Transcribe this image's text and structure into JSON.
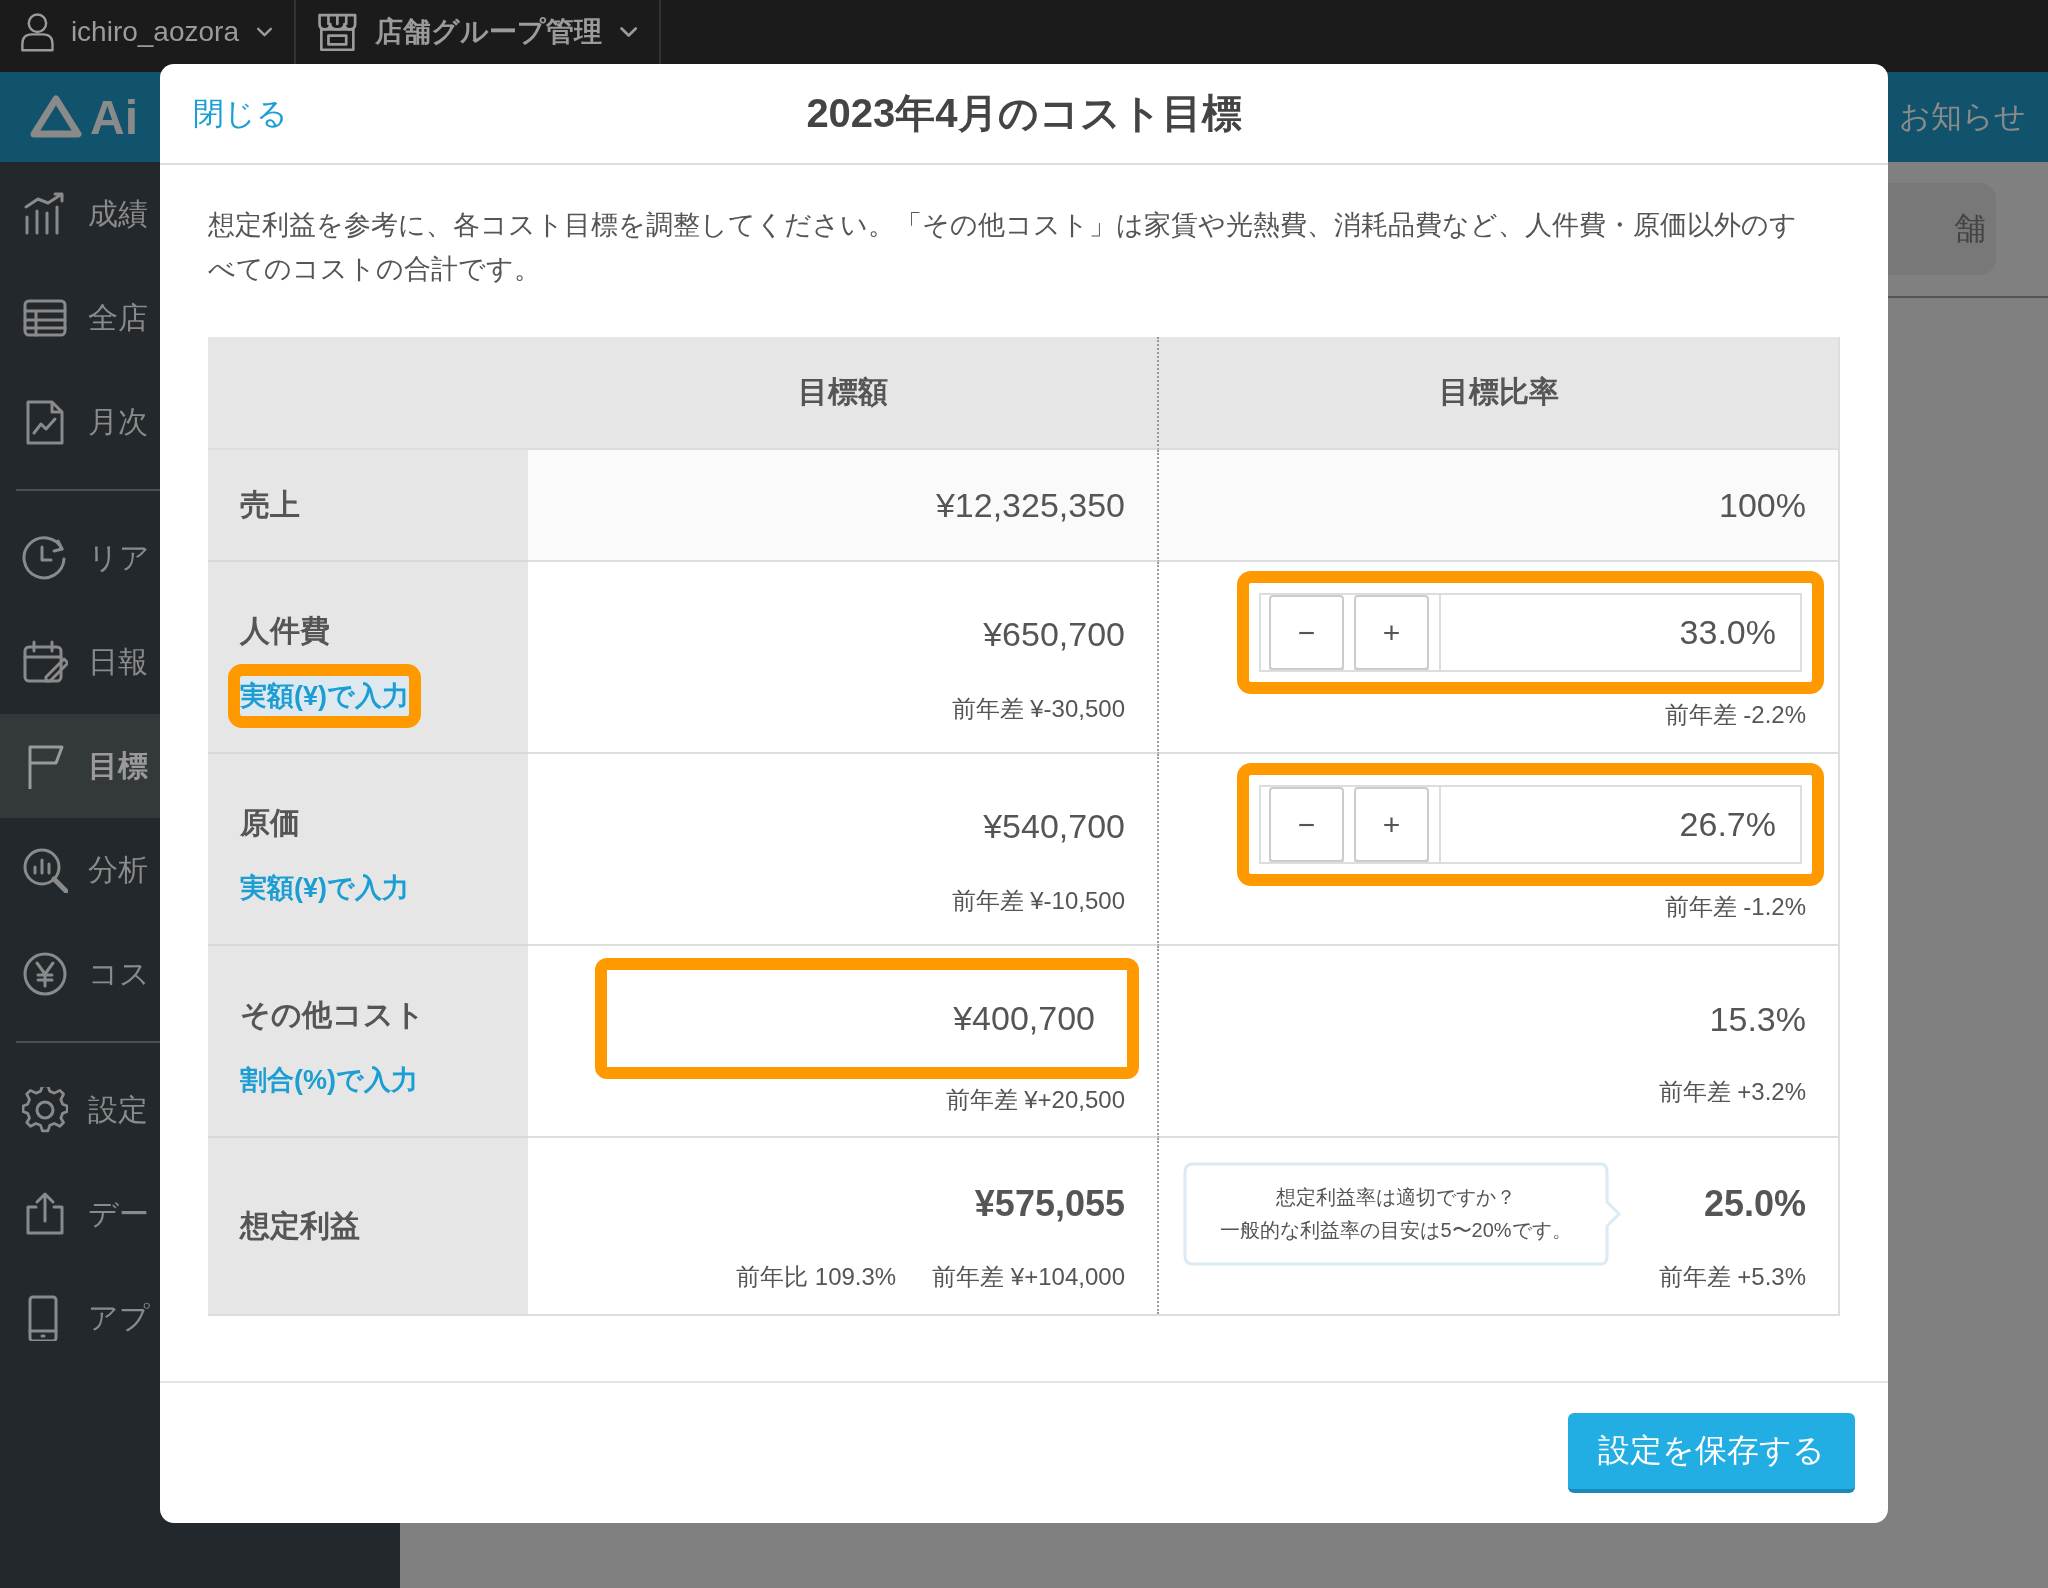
{
  "top_bar": {
    "user": "ichiro_aozora",
    "group_menu": "店舗グループ管理"
  },
  "header": {
    "logo": "Ai",
    "notice": "お知らせ"
  },
  "sidebar": {
    "groups": [
      [
        {
          "label": "成績",
          "selected": false
        },
        {
          "label": "全店",
          "selected": false
        },
        {
          "label": "月次",
          "selected": false
        }
      ],
      [
        {
          "label": "リア",
          "selected": false
        },
        {
          "label": "日報",
          "selected": false
        },
        {
          "label": "目標",
          "selected": true
        },
        {
          "label": "分析",
          "selected": false
        },
        {
          "label": "コス",
          "selected": false
        }
      ],
      [
        {
          "label": "設定",
          "selected": false
        },
        {
          "label": "デー",
          "selected": false
        },
        {
          "label": "アプ",
          "selected": false
        }
      ]
    ]
  },
  "background_button": "舗",
  "modal": {
    "close": "閉じる",
    "title": "2023年4月のコスト目標",
    "description": "想定利益を参考に、各コスト目標を調整してください。「その他コスト」は家賃や光熱費、消耗品費など、人件費・原価以外のすべてのコストの合計です。",
    "columns": [
      "目標額",
      "目標比率"
    ],
    "rows": [
      {
        "kind": "plain",
        "label": "売上",
        "amount": "¥12,325,350",
        "ratio": "100%"
      },
      {
        "kind": "ratio_input",
        "label": "人件費",
        "link": "実額(¥)で入力",
        "link_highlighted": true,
        "amount": "¥650,700",
        "amount_diff": "前年差 ¥-30,500",
        "minus": "−",
        "plus": "+",
        "ratio": "33.0%",
        "input_highlighted": true,
        "ratio_diff": "前年差 -2.2%"
      },
      {
        "kind": "ratio_input",
        "label": "原価",
        "link": "実額(¥)で入力",
        "link_highlighted": false,
        "amount": "¥540,700",
        "amount_diff": "前年差 ¥-10,500",
        "minus": "−",
        "plus": "+",
        "ratio": "26.7%",
        "input_highlighted": true,
        "ratio_diff": "前年差 -1.2%"
      },
      {
        "kind": "amount_input",
        "label": "その他コスト",
        "link": "割合(%)で入力",
        "link_highlighted": false,
        "amount": "¥400,700",
        "input_highlighted": true,
        "amount_diff": "前年差 ¥+20,500",
        "ratio": "15.3%",
        "ratio_diff": "前年差 +3.2%"
      },
      {
        "kind": "total",
        "label": "想定利益",
        "amount": "¥575,055",
        "amount_notes": [
          "前年比 109.3%",
          "前年差 ¥+104,000"
        ],
        "tooltip": [
          "想定利益率は適切ですか？",
          "一般的な利益率の目安は5〜20%です。"
        ],
        "ratio": "25.0%",
        "ratio_diff": "前年差 +5.3%"
      }
    ],
    "save": "設定を保存する"
  }
}
